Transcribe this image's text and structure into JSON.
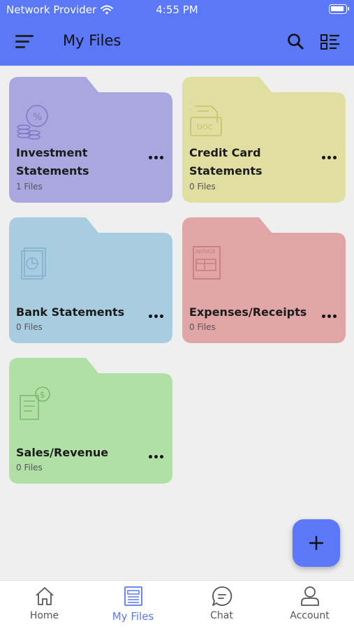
{
  "status_bar": {
    "carrier": "Network Provider",
    "time": "4:55 PM"
  },
  "app_bar": {
    "title": "My Files"
  },
  "folders": [
    {
      "name": "Investment Statements",
      "line1": "Investment",
      "line2": "Statements",
      "count": "1 Files",
      "color": "#aaa6e0",
      "icon": "investment-percent-icon"
    },
    {
      "name": "Credit Card Statements",
      "line1": "Credit Card",
      "line2": "Statements",
      "count": "0 Files",
      "color": "#e1dea2",
      "icon": "document-doc-icon"
    },
    {
      "name": "Bank Statements",
      "line1": "Bank Statements",
      "line2": "",
      "count": "0 Files",
      "color": "#a9cde0",
      "icon": "report-chart-icon"
    },
    {
      "name": "Expenses/Receipts",
      "line1": "Expenses/Receipts",
      "line2": "",
      "count": "0 Files",
      "color": "#e2a5a5",
      "icon": "invoice-icon"
    },
    {
      "name": "Sales/Revenue",
      "line1": "Sales/Revenue",
      "line2": "",
      "count": "0 Files",
      "color": "#b0e0a6",
      "icon": "sales-receipt-dollar-icon"
    }
  ],
  "fab": {
    "label": "+"
  },
  "bottom_nav": [
    {
      "label": "Home",
      "icon": "home-icon",
      "active": false
    },
    {
      "label": "My Files",
      "icon": "files-icon",
      "active": true
    },
    {
      "label": "Chat",
      "icon": "chat-icon",
      "active": false
    },
    {
      "label": "Account",
      "icon": "account-icon",
      "active": false
    }
  ],
  "colors": {
    "primary": "#5a78f7",
    "background": "#efefef"
  }
}
